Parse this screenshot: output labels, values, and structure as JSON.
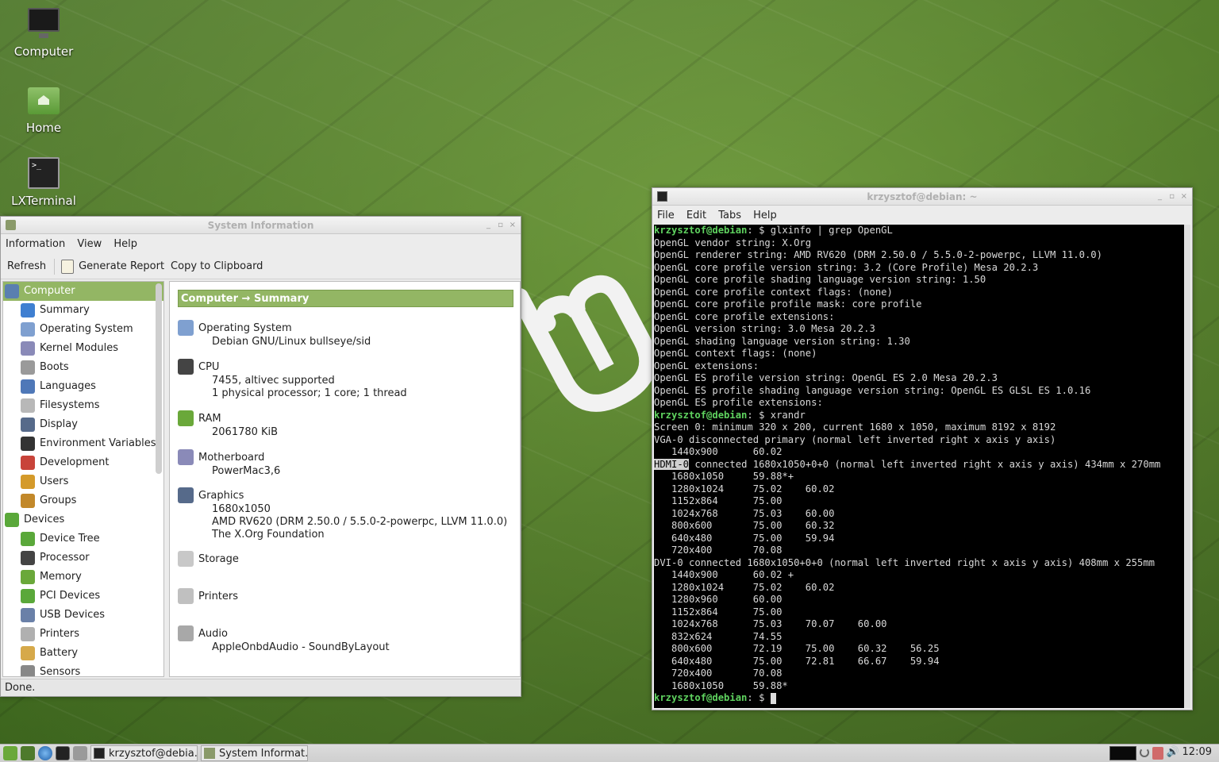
{
  "desktop": {
    "icons": [
      {
        "label": "Computer",
        "icon": "monitor-icon"
      },
      {
        "label": "Home",
        "icon": "home-folder-icon"
      },
      {
        "label": "LXTerminal",
        "icon": "terminal-icon"
      }
    ]
  },
  "sysinfo": {
    "title": "System Information",
    "menu": [
      "Information",
      "View",
      "Help"
    ],
    "toolbar": {
      "refresh": "Refresh",
      "generate": "Generate Report",
      "copy": "Copy to Clipboard"
    },
    "sidebar": [
      {
        "label": "Computer",
        "level": 0,
        "selected": true,
        "icon": "computer-icon",
        "color": "#5a7fb0"
      },
      {
        "label": "Summary",
        "level": 1,
        "icon": "info-icon",
        "color": "#3f7fd1"
      },
      {
        "label": "Operating System",
        "level": 1,
        "icon": "gear-icon",
        "color": "#7fa0d0"
      },
      {
        "label": "Kernel Modules",
        "level": 1,
        "icon": "module-icon",
        "color": "#8a8ab8"
      },
      {
        "label": "Boots",
        "level": 1,
        "icon": "power-icon",
        "color": "#9a9a9a"
      },
      {
        "label": "Languages",
        "level": 1,
        "icon": "flag-icon",
        "color": "#4f78b8"
      },
      {
        "label": "Filesystems",
        "level": 1,
        "icon": "drive-icon",
        "color": "#b8b8b8"
      },
      {
        "label": "Display",
        "level": 1,
        "icon": "display-icon",
        "color": "#566a8a"
      },
      {
        "label": "Environment Variables",
        "level": 1,
        "icon": "terminal-icon",
        "color": "#333333"
      },
      {
        "label": "Development",
        "level": 1,
        "icon": "toolbox-icon",
        "color": "#c8443a"
      },
      {
        "label": "Users",
        "level": 1,
        "icon": "users-icon",
        "color": "#d49a2a"
      },
      {
        "label": "Groups",
        "level": 1,
        "icon": "groups-icon",
        "color": "#c2882a"
      },
      {
        "label": "Devices",
        "level": 0,
        "icon": "board-icon",
        "color": "#5aa83a"
      },
      {
        "label": "Device Tree",
        "level": 1,
        "icon": "board-icon",
        "color": "#5aa83a"
      },
      {
        "label": "Processor",
        "level": 1,
        "icon": "cpu-icon",
        "color": "#444444"
      },
      {
        "label": "Memory",
        "level": 1,
        "icon": "memory-icon",
        "color": "#6aa83a"
      },
      {
        "label": "PCI Devices",
        "level": 1,
        "icon": "pci-icon",
        "color": "#5aa83a"
      },
      {
        "label": "USB Devices",
        "level": 1,
        "icon": "usb-icon",
        "color": "#6a80a8"
      },
      {
        "label": "Printers",
        "level": 1,
        "icon": "printer-icon",
        "color": "#b0b0b0"
      },
      {
        "label": "Battery",
        "level": 1,
        "icon": "battery-icon",
        "color": "#d6a94a"
      },
      {
        "label": "Sensors",
        "level": 1,
        "icon": "sensor-icon",
        "color": "#888888"
      }
    ],
    "header": "Computer → Summary",
    "sections": [
      {
        "title": "Operating System",
        "icon": "gear-icon",
        "color": "#7fa0d0",
        "values": [
          "Debian GNU/Linux bullseye/sid"
        ]
      },
      {
        "title": "CPU",
        "icon": "cpu-icon",
        "color": "#444444",
        "values": [
          "7455, altivec supported",
          "1 physical processor; 1 core; 1 thread"
        ]
      },
      {
        "title": "RAM",
        "icon": "memory-icon",
        "color": "#6aa83a",
        "values": [
          "2061780 KiB"
        ]
      },
      {
        "title": "Motherboard",
        "icon": "module-icon",
        "color": "#8a8ab8",
        "values": [
          "PowerMac3,6"
        ]
      },
      {
        "title": "Graphics",
        "icon": "display-icon",
        "color": "#566a8a",
        "values": [
          "1680x1050",
          "AMD RV620 (DRM 2.50.0 / 5.5.0-2-powerpc, LLVM 11.0.0)",
          "The X.Org Foundation"
        ]
      },
      {
        "title": "Storage",
        "icon": "drive-icon",
        "color": "#c8c8c8",
        "values": []
      },
      {
        "title": "Printers",
        "icon": "printer-icon",
        "color": "#c0c0c0",
        "values": []
      },
      {
        "title": "Audio",
        "icon": "speaker-icon",
        "color": "#a8a8a8",
        "values": [
          "AppleOnbdAudio - SoundByLayout"
        ]
      }
    ],
    "status": "Done."
  },
  "terminal": {
    "title": "krzysztof@debian: ~",
    "menu": [
      "File",
      "Edit",
      "Tabs",
      "Help"
    ],
    "lines": [
      {
        "prompt": "krzysztof@debian",
        "text": ": $ glxinfo | grep OpenGL"
      },
      {
        "text": "OpenGL vendor string: X.Org"
      },
      {
        "text": "OpenGL renderer string: AMD RV620 (DRM 2.50.0 / 5.5.0-2-powerpc, LLVM 11.0.0)"
      },
      {
        "text": "OpenGL core profile version string: 3.2 (Core Profile) Mesa 20.2.3"
      },
      {
        "text": "OpenGL core profile shading language version string: 1.50"
      },
      {
        "text": "OpenGL core profile context flags: (none)"
      },
      {
        "text": "OpenGL core profile profile mask: core profile"
      },
      {
        "text": "OpenGL core profile extensions:"
      },
      {
        "text": "OpenGL version string: 3.0 Mesa 20.2.3"
      },
      {
        "text": "OpenGL shading language version string: 1.30"
      },
      {
        "text": "OpenGL context flags: (none)"
      },
      {
        "text": "OpenGL extensions:"
      },
      {
        "text": "OpenGL ES profile version string: OpenGL ES 2.0 Mesa 20.2.3"
      },
      {
        "text": "OpenGL ES profile shading language version string: OpenGL ES GLSL ES 1.0.16"
      },
      {
        "text": "OpenGL ES profile extensions:"
      },
      {
        "prompt": "krzysztof@debian",
        "text": ": $ xrandr"
      },
      {
        "text": "Screen 0: minimum 320 x 200, current 1680 x 1050, maximum 8192 x 8192"
      },
      {
        "text": "VGA-0 disconnected primary (normal left inverted right x axis y axis)"
      },
      {
        "text": "   1440x900      60.02"
      },
      {
        "highlight": "HDMI-0",
        "text": " connected 1680x1050+0+0 (normal left inverted right x axis y axis) 434mm x 270mm"
      },
      {
        "text": "   1680x1050     59.88*+"
      },
      {
        "text": "   1280x1024     75.02    60.02"
      },
      {
        "text": "   1152x864      75.00"
      },
      {
        "text": "   1024x768      75.03    60.00"
      },
      {
        "text": "   800x600       75.00    60.32"
      },
      {
        "text": "   640x480       75.00    59.94"
      },
      {
        "text": "   720x400       70.08"
      },
      {
        "text": "DVI-0 connected 1680x1050+0+0 (normal left inverted right x axis y axis) 408mm x 255mm"
      },
      {
        "text": "   1440x900      60.02 +"
      },
      {
        "text": "   1280x1024     75.02    60.02"
      },
      {
        "text": "   1280x960      60.00"
      },
      {
        "text": "   1152x864      75.00"
      },
      {
        "text": "   1024x768      75.03    70.07    60.00"
      },
      {
        "text": "   832x624       74.55"
      },
      {
        "text": "   800x600       72.19    75.00    60.32    56.25"
      },
      {
        "text": "   640x480       75.00    72.81    66.67    59.94"
      },
      {
        "text": "   720x400       70.08"
      },
      {
        "text": "   1680x1050     59.88*"
      },
      {
        "prompt": "krzysztof@debian",
        "text": ": $ ",
        "cursor": true
      }
    ]
  },
  "taskbar": {
    "tasks": [
      {
        "label": "krzysztof@debia...",
        "icon": "terminal-icon"
      },
      {
        "label": "System Informat...",
        "icon": "sysinfo-icon"
      }
    ],
    "clock": "12:09"
  }
}
